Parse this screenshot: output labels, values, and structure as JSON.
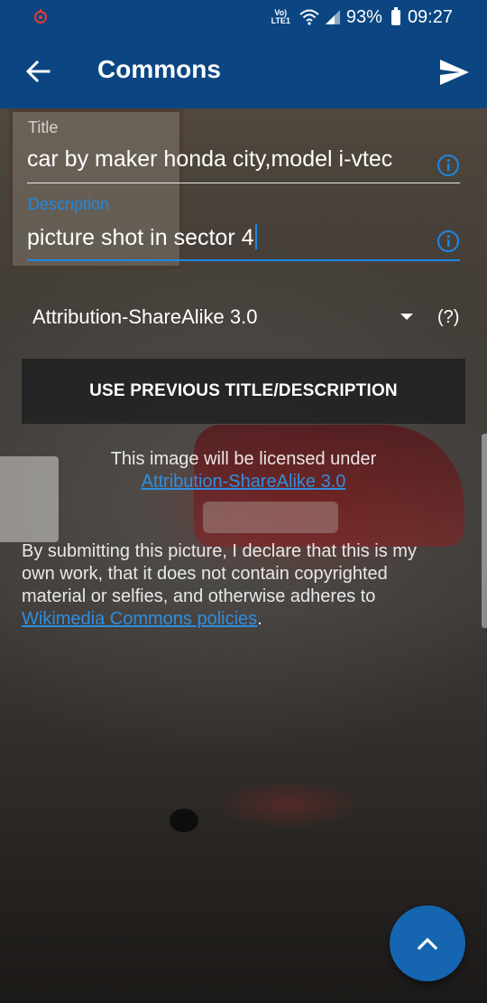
{
  "status_bar": {
    "network_label": "VoLTE LTE1",
    "battery": "93%",
    "time": "09:27",
    "icons": [
      "app-notification-icon",
      "volte-icon",
      "wifi-icon",
      "signal-icon",
      "battery-icon"
    ]
  },
  "app_bar": {
    "title": "Commons",
    "back_icon": "arrow-back-icon",
    "send_icon": "send-icon"
  },
  "form": {
    "title_label": "Title",
    "title_value": "car by maker honda city,model i-vtec",
    "description_label": "Description",
    "description_value": "picture shot in sector 4",
    "license_selected": "Attribution-ShareAlike 3.0",
    "license_help": "(?)",
    "use_previous_button": "USE PREVIOUS TITLE/DESCRIPTION"
  },
  "license_notice": {
    "text": "This image will be licensed under",
    "link": "Attribution-ShareAlike 3.0"
  },
  "declaration": {
    "text": "By submitting this picture, I declare that this is my own work, that it does not contain copyrighted material or selfies, and otherwise adheres to",
    "link": "Wikimedia Commons policies",
    "suffix": "."
  },
  "fab": {
    "icon": "chevron-up-icon"
  },
  "colors": {
    "primary": "#0b4682",
    "accent": "#1e88e5",
    "link": "#2f8ee0",
    "fab": "#1565b0"
  }
}
